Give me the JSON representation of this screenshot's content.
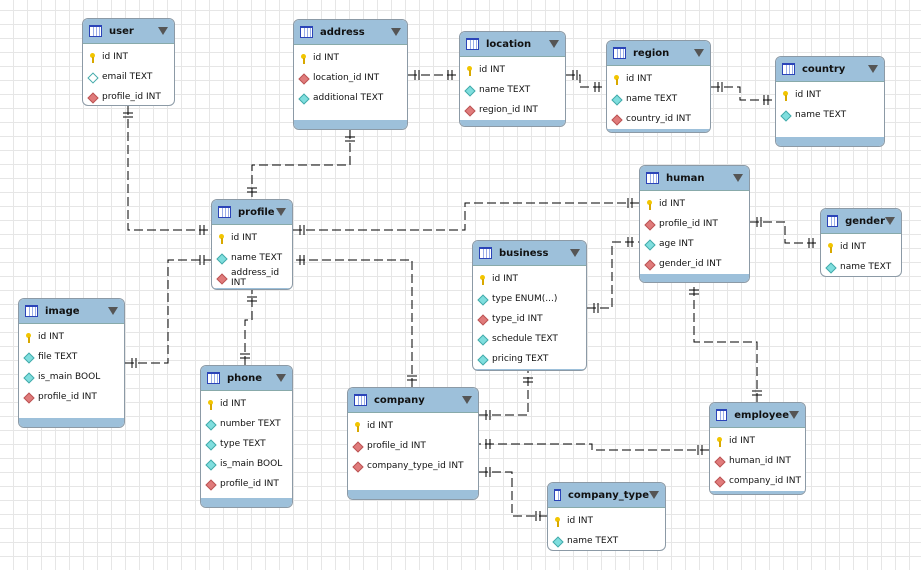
{
  "tables": [
    {
      "id": "user",
      "name": "user",
      "columns": [
        {
          "label": "id INT",
          "kind": "pk"
        },
        {
          "label": "email TEXT",
          "kind": "nul"
        },
        {
          "label": "profile_id INT",
          "kind": "fk"
        }
      ]
    },
    {
      "id": "address",
      "name": "address",
      "columns": [
        {
          "label": "id INT",
          "kind": "pk"
        },
        {
          "label": "location_id INT",
          "kind": "fk"
        },
        {
          "label": "additional TEXT",
          "kind": "col"
        }
      ]
    },
    {
      "id": "location",
      "name": "location",
      "columns": [
        {
          "label": "id INT",
          "kind": "pk"
        },
        {
          "label": "name TEXT",
          "kind": "col"
        },
        {
          "label": "region_id INT",
          "kind": "fk"
        }
      ]
    },
    {
      "id": "region",
      "name": "region",
      "columns": [
        {
          "label": "id INT",
          "kind": "pk"
        },
        {
          "label": "name TEXT",
          "kind": "col"
        },
        {
          "label": "country_id INT",
          "kind": "fk"
        }
      ]
    },
    {
      "id": "country",
      "name": "country",
      "columns": [
        {
          "label": "id INT",
          "kind": "pk"
        },
        {
          "label": "name TEXT",
          "kind": "col"
        }
      ]
    },
    {
      "id": "profile",
      "name": "profile",
      "columns": [
        {
          "label": "id INT",
          "kind": "pk"
        },
        {
          "label": "name TEXT",
          "kind": "col"
        },
        {
          "label": "address_id INT",
          "kind": "fk"
        }
      ]
    },
    {
      "id": "human",
      "name": "human",
      "columns": [
        {
          "label": "id INT",
          "kind": "pk"
        },
        {
          "label": "profile_id INT",
          "kind": "fk"
        },
        {
          "label": "age INT",
          "kind": "col"
        },
        {
          "label": "gender_id INT",
          "kind": "fk"
        }
      ]
    },
    {
      "id": "gender",
      "name": "gender",
      "columns": [
        {
          "label": "id INT",
          "kind": "pk"
        },
        {
          "label": "name TEXT",
          "kind": "col"
        }
      ]
    },
    {
      "id": "business",
      "name": "business",
      "columns": [
        {
          "label": "id INT",
          "kind": "pk"
        },
        {
          "label": "type ENUM(...)",
          "kind": "col"
        },
        {
          "label": "type_id INT",
          "kind": "fk"
        },
        {
          "label": "schedule TEXT",
          "kind": "col"
        },
        {
          "label": "pricing TEXT",
          "kind": "col"
        }
      ]
    },
    {
      "id": "image",
      "name": "image",
      "columns": [
        {
          "label": "id INT",
          "kind": "pk"
        },
        {
          "label": "file TEXT",
          "kind": "col"
        },
        {
          "label": "is_main BOOL",
          "kind": "col"
        },
        {
          "label": "profile_id INT",
          "kind": "fk"
        }
      ]
    },
    {
      "id": "phone",
      "name": "phone",
      "columns": [
        {
          "label": "id INT",
          "kind": "pk"
        },
        {
          "label": "number TEXT",
          "kind": "col"
        },
        {
          "label": "type TEXT",
          "kind": "col"
        },
        {
          "label": "is_main BOOL",
          "kind": "col"
        },
        {
          "label": "profile_id INT",
          "kind": "fk"
        }
      ]
    },
    {
      "id": "company",
      "name": "company",
      "columns": [
        {
          "label": "id INT",
          "kind": "pk"
        },
        {
          "label": "profile_id INT",
          "kind": "fk"
        },
        {
          "label": "company_type_id INT",
          "kind": "fk"
        }
      ]
    },
    {
      "id": "employee",
      "name": "employee",
      "columns": [
        {
          "label": "id INT",
          "kind": "pk"
        },
        {
          "label": "human_id INT",
          "kind": "fk"
        },
        {
          "label": "company_id INT",
          "kind": "fk"
        }
      ]
    },
    {
      "id": "company_type",
      "name": "company_type",
      "columns": [
        {
          "label": "id INT",
          "kind": "pk"
        },
        {
          "label": "name TEXT",
          "kind": "col"
        }
      ]
    }
  ],
  "relationships": [
    {
      "from": "user",
      "to": "profile"
    },
    {
      "from": "address",
      "to": "profile"
    },
    {
      "from": "address",
      "to": "location"
    },
    {
      "from": "location",
      "to": "region"
    },
    {
      "from": "region",
      "to": "country"
    },
    {
      "from": "profile",
      "to": "human"
    },
    {
      "from": "human",
      "to": "gender"
    },
    {
      "from": "business",
      "to": "human"
    },
    {
      "from": "image",
      "to": "profile"
    },
    {
      "from": "phone",
      "to": "profile"
    },
    {
      "from": "company",
      "to": "profile"
    },
    {
      "from": "company",
      "to": "business"
    },
    {
      "from": "employee",
      "to": "company"
    },
    {
      "from": "company",
      "to": "company_type"
    },
    {
      "from": "employee",
      "to": "human"
    }
  ],
  "colors": {
    "header": "#9dc0da",
    "border": "#8c9aa6",
    "line": "#000000"
  }
}
